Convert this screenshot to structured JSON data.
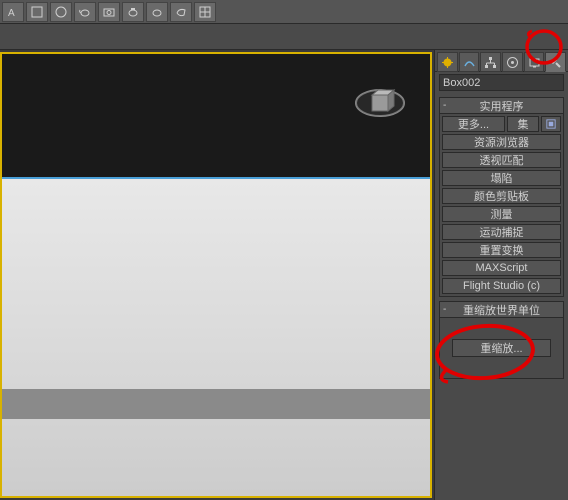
{
  "toolbar_icons": [
    "text-icon",
    "box-icon",
    "sphere-icon",
    "teapot-icon",
    "snapshot-icon",
    "teapot2-icon",
    "teapot3-icon",
    "teapot4-icon",
    "grid-icon"
  ],
  "object_name": "Box002",
  "panel_tabs": [
    "create",
    "modify",
    "hierarchy",
    "motion",
    "display",
    "utilities"
  ],
  "active_tab": 5,
  "rollout_utilities": {
    "title": "实用程序",
    "more_label": "更多...",
    "set_label": "集",
    "buttons": [
      "资源浏览器",
      "透视匹配",
      "塌陷",
      "颜色剪贴板",
      "测量",
      "运动捕捉",
      "重置变换",
      "MAXScript",
      "Flight Studio (c)"
    ]
  },
  "rollout_rescale": {
    "title": "重缩放世界单位",
    "button": "重缩放..."
  },
  "highlight_color": "#e00000"
}
